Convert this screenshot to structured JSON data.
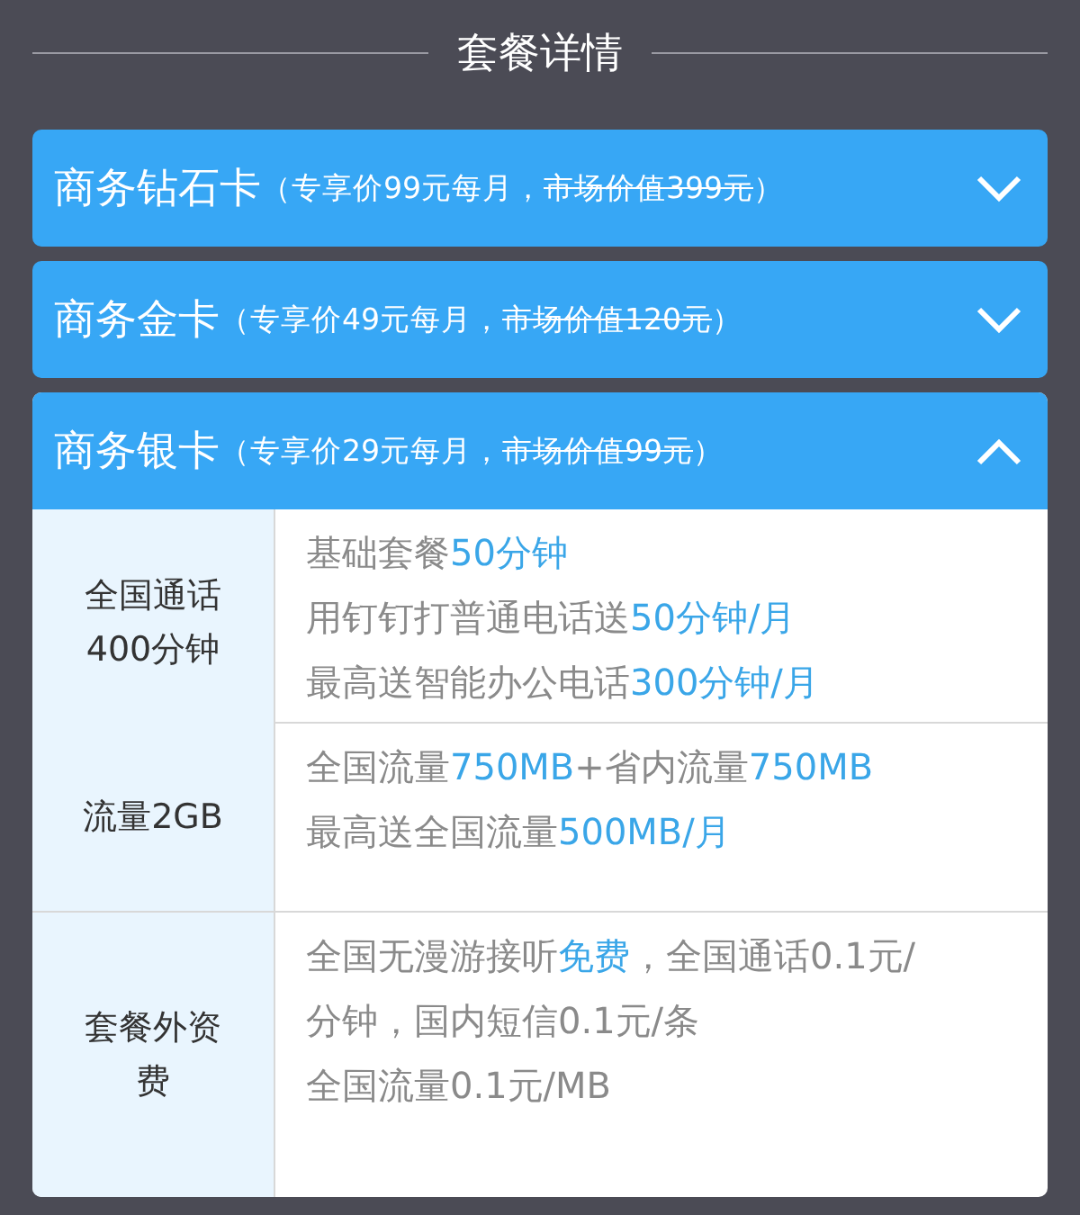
{
  "title": "套餐详情",
  "plans": [
    {
      "name": "商务钻石卡",
      "note": [
        {
          "text": "（专享价99元每月，",
          "struck": false
        },
        {
          "text": "市场价值399元",
          "struck": true
        },
        {
          "text": "）",
          "struck": false
        }
      ],
      "expanded": false
    },
    {
      "name": "商务金卡",
      "note": [
        {
          "text": "（专享价49元每月，",
          "struck": false
        },
        {
          "text": "市场价值120元",
          "struck": true
        },
        {
          "text": "）",
          "struck": false
        }
      ],
      "expanded": false
    },
    {
      "name": "商务银卡",
      "note": [
        {
          "text": "（专享价29元每月，",
          "struck": false
        },
        {
          "text": "市场价值99元",
          "struck": true
        },
        {
          "text": "）",
          "struck": false
        }
      ],
      "expanded": true,
      "rows": [
        {
          "label": "全国通话400分钟",
          "lines": [
            [
              {
                "text": "基础套餐",
                "highlight": false
              },
              {
                "text": "50分钟",
                "highlight": true
              }
            ],
            [
              {
                "text": "用钉钉打普通电话送",
                "highlight": false
              },
              {
                "text": "50分钟/月",
                "highlight": true
              }
            ],
            [
              {
                "text": "最高送智能办公电话",
                "highlight": false
              },
              {
                "text": "300分钟/月",
                "highlight": true
              }
            ]
          ]
        },
        {
          "label": "流量2GB",
          "lines": [
            [
              {
                "text": "全国流量",
                "highlight": false
              },
              {
                "text": "750MB",
                "highlight": true
              },
              {
                "text": "+省内流量",
                "highlight": false
              },
              {
                "text": "750MB",
                "highlight": true
              }
            ],
            [
              {
                "text": "最高送全国流量",
                "highlight": false
              },
              {
                "text": "500MB/月",
                "highlight": true
              }
            ]
          ]
        },
        {
          "label": "套餐外资费",
          "lines": [
            [
              {
                "text": "全国无漫游接听",
                "highlight": false
              },
              {
                "text": "免费",
                "highlight": true
              },
              {
                "text": "，全国通话0.1元/分钟，国内短信0.1元/条",
                "highlight": false
              }
            ],
            [
              {
                "text": "全国流量0.1元/MB",
                "highlight": false
              }
            ]
          ]
        }
      ]
    }
  ]
}
